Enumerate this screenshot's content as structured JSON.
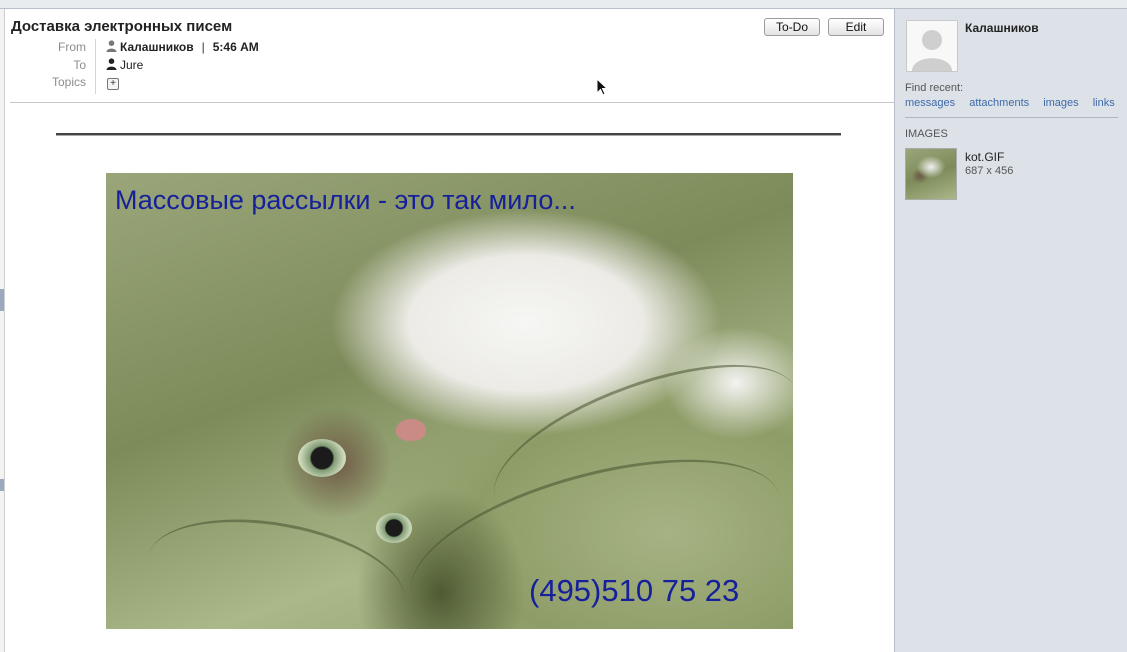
{
  "message": {
    "subject": "Доставка электронных писем",
    "buttons": {
      "todo": "To-Do",
      "edit": "Edit"
    },
    "labels": {
      "from": "From",
      "to": "To",
      "topics": "Topics"
    },
    "from_name": "Калашников",
    "time": "5:46 AM",
    "separator": "|",
    "to_name": "Jure",
    "topics_add_glyph": "+"
  },
  "image": {
    "caption_top": "Массовые рассылки - это так мило...",
    "caption_phone": "(495)510 75 23"
  },
  "sidebar": {
    "contact_name": "Калашников",
    "find_recent_label": "Find recent:",
    "links": [
      "messages",
      "attachments",
      "images",
      "links"
    ],
    "images_heading": "IMAGES",
    "attachment": {
      "file_name": "kot.GIF",
      "dimensions": "687 x 456"
    }
  },
  "colors": {
    "caption": "#15209a",
    "sidebar_bg": "#dde2e9",
    "link": "#3d6aa8"
  },
  "icons": [
    "person-icon",
    "add-topic-icon",
    "avatar-placeholder-icon",
    "mouse-pointer-icon"
  ]
}
